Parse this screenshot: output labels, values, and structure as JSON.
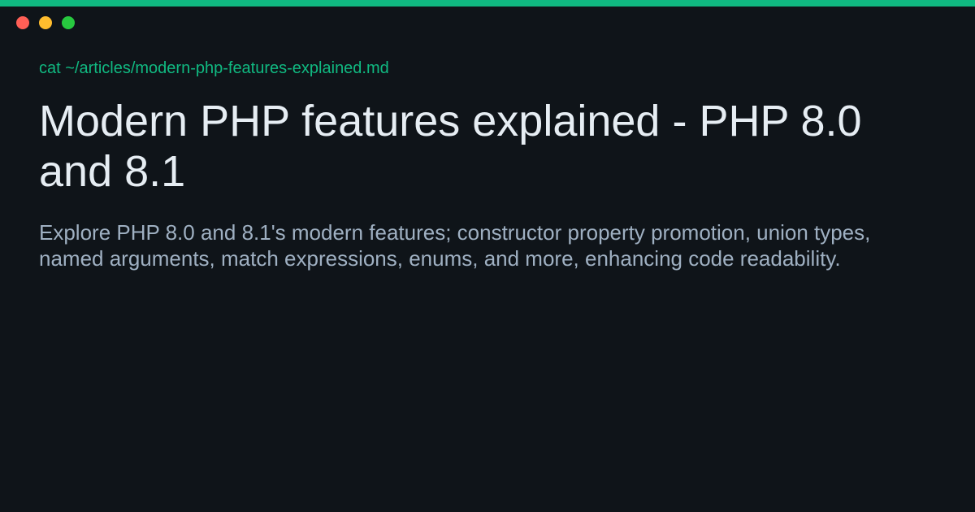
{
  "theme": {
    "accent": "#10b981",
    "background": "#0f1419",
    "title_color": "#e6edf3",
    "description_color": "#9fb0c2",
    "dot_red": "#ff5f56",
    "dot_yellow": "#ffbd2e",
    "dot_green": "#27c93f"
  },
  "window": {
    "controls": [
      "close-dot",
      "minimize-dot",
      "maximize-dot"
    ]
  },
  "article": {
    "command": "cat ~/articles/modern-php-features-explained.md",
    "title": "Modern PHP features explained - PHP 8.0 and 8.1",
    "description": "Explore PHP 8.0 and 8.1's modern features; constructor property promotion, union types, named arguments, match expressions, enums, and more, enhancing code readability."
  }
}
